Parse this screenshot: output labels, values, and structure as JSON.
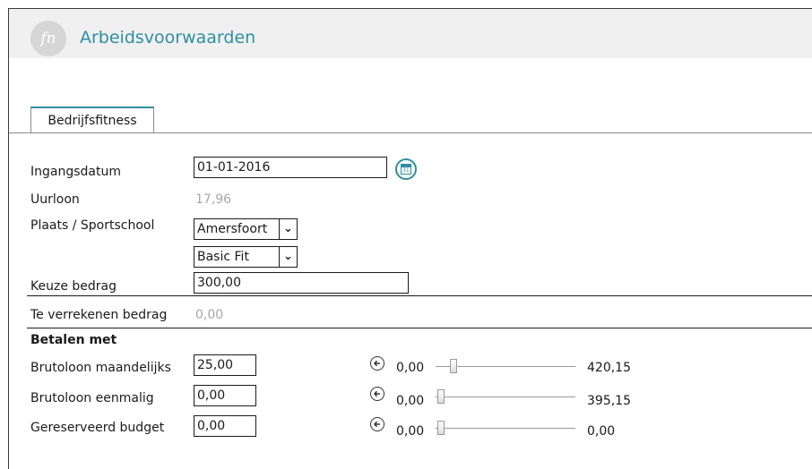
{
  "app": {
    "title": "Arbeidsvoorwaarden",
    "logo_text": "fn"
  },
  "tabs": [
    {
      "label": "Bedrijfsfitness"
    }
  ],
  "form": {
    "ingangsdatum": {
      "label": "Ingangsdatum",
      "value": "01-01-2016"
    },
    "uurloon": {
      "label": "Uurloon",
      "value": "17,96"
    },
    "plaats": {
      "label": "Plaats / Sportschool",
      "city": "Amersfoort",
      "gym": "Basic Fit"
    },
    "keuze": {
      "label": "Keuze bedrag",
      "value": "300,00"
    },
    "verrekenen": {
      "label": "Te verrekenen bedrag",
      "value": "0,00"
    }
  },
  "betalen": {
    "heading": "Betalen met",
    "rows": [
      {
        "label": "Brutoloon maandelijks",
        "value": "25,00",
        "min": "0,00",
        "max": "420,15",
        "level": 0.06
      },
      {
        "label": "Brutoloon eenmalig",
        "value": "0,00",
        "min": "0,00",
        "max": "395,15",
        "level": 0.0
      },
      {
        "label": "Gereserveerd budget",
        "value": "0,00",
        "min": "0,00",
        "max": "0,00",
        "level": 0.0
      }
    ]
  },
  "colors": {
    "accent": "#2e8ea2",
    "header_bg": "#f0f0f0",
    "muted": "#a8a8a8"
  },
  "icons": {
    "calendar": "calendar-icon",
    "reset": "arrow-left-circle-icon",
    "dropdown": "chevron-down-icon"
  }
}
